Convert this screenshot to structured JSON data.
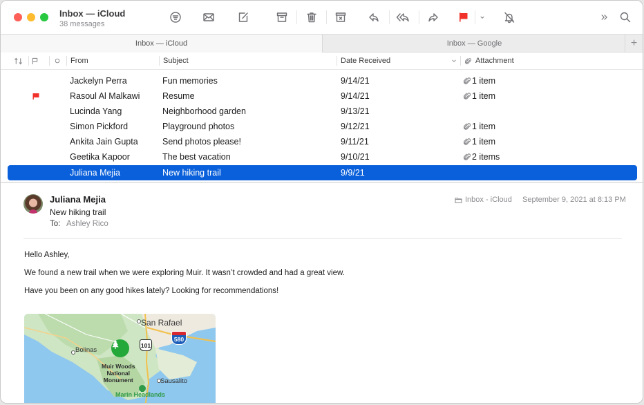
{
  "window": {
    "title": "Inbox — iCloud",
    "subtitle": "38 messages"
  },
  "toolbar": {
    "buttons": [
      {
        "name": "filter",
        "icon": "filter-icon"
      },
      {
        "name": "get-mail",
        "icon": "envelope-icon"
      },
      {
        "name": "compose",
        "icon": "compose-icon"
      },
      {
        "name": "archive",
        "icon": "archive-icon"
      },
      {
        "name": "delete",
        "icon": "trash-icon"
      },
      {
        "name": "junk",
        "icon": "junk-icon"
      },
      {
        "name": "reply",
        "icon": "reply-icon"
      },
      {
        "name": "reply-all",
        "icon": "reply-all-icon"
      },
      {
        "name": "forward",
        "icon": "forward-icon"
      },
      {
        "name": "flag",
        "icon": "flag-icon"
      },
      {
        "name": "flag-menu",
        "icon": "chevron-down-icon"
      },
      {
        "name": "mute",
        "icon": "bell-slash-icon"
      },
      {
        "name": "more",
        "icon": "chevron-double-right-icon"
      },
      {
        "name": "search",
        "icon": "search-icon"
      }
    ],
    "flag_color": "#f0322b"
  },
  "tabs": [
    {
      "label": "Inbox — iCloud",
      "active": true
    },
    {
      "label": "Inbox — Google",
      "active": false
    }
  ],
  "tab_add_label": "+",
  "columns": {
    "sort": "sort-icon",
    "flag": "flag-icon",
    "unread": "unread-dot-icon",
    "from": "From",
    "subject": "Subject",
    "date": "Date Received",
    "attachment": "Attachment"
  },
  "messages": [
    {
      "from": "Jackelyn Perra",
      "subject": "Fun memories",
      "date": "9/14/21",
      "attachment": "1 item",
      "flagged": false,
      "selected": false
    },
    {
      "from": "Rasoul Al Malkawi",
      "subject": "Resume",
      "date": "9/14/21",
      "attachment": "1 item",
      "flagged": true,
      "selected": false
    },
    {
      "from": "Lucinda Yang",
      "subject": "Neighborhood garden",
      "date": "9/13/21",
      "attachment": "",
      "flagged": false,
      "selected": false
    },
    {
      "from": "Simon Pickford",
      "subject": "Playground photos",
      "date": "9/12/21",
      "attachment": "1 item",
      "flagged": false,
      "selected": false
    },
    {
      "from": "Ankita Jain Gupta",
      "subject": "Send photos please!",
      "date": "9/11/21",
      "attachment": "1 item",
      "flagged": false,
      "selected": false
    },
    {
      "from": "Geetika Kapoor",
      "subject": "The best vacation",
      "date": "9/10/21",
      "attachment": "2 items",
      "flagged": false,
      "selected": false
    },
    {
      "from": "Juliana Mejia",
      "subject": "New hiking trail",
      "date": "9/9/21",
      "attachment": "",
      "flagged": false,
      "selected": true
    }
  ],
  "selection_color": "#0a60db",
  "viewer": {
    "sender": "Juliana Mejia",
    "subject": "New hiking trail",
    "to_label": "To:",
    "to": "Ashley Rico",
    "mailbox": "Inbox - iCloud",
    "date": "September 9, 2021 at 8:13 PM",
    "body": [
      "Hello Ashley,",
      "We found a new trail when we were exploring Muir. It wasn’t crowded and had a great view.",
      "Have you been on any good hikes lately? Looking for recommendations!"
    ],
    "map": {
      "labels": {
        "san_rafael": "San Rafael",
        "bolinas": "Bolinas",
        "muir_line1": "Muir Woods",
        "muir_line2": "National",
        "muir_line3": "Monument",
        "sausalito": "Sausalito",
        "marin": "Marin Headlands",
        "hwy101": "101",
        "i580": "580"
      }
    }
  }
}
